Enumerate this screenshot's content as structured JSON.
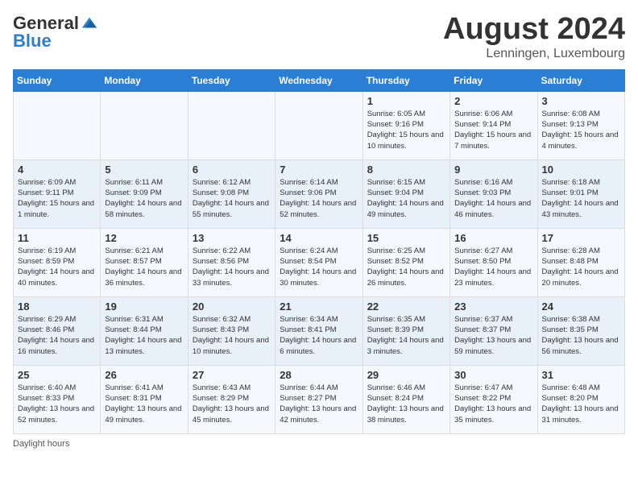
{
  "header": {
    "logo_general": "General",
    "logo_blue": "Blue",
    "month_year": "August 2024",
    "location": "Lenningen, Luxembourg"
  },
  "days_of_week": [
    "Sunday",
    "Monday",
    "Tuesday",
    "Wednesday",
    "Thursday",
    "Friday",
    "Saturday"
  ],
  "weeks": [
    [
      {
        "num": "",
        "detail": ""
      },
      {
        "num": "",
        "detail": ""
      },
      {
        "num": "",
        "detail": ""
      },
      {
        "num": "",
        "detail": ""
      },
      {
        "num": "1",
        "detail": "Sunrise: 6:05 AM\nSunset: 9:16 PM\nDaylight: 15 hours\nand 10 minutes."
      },
      {
        "num": "2",
        "detail": "Sunrise: 6:06 AM\nSunset: 9:14 PM\nDaylight: 15 hours\nand 7 minutes."
      },
      {
        "num": "3",
        "detail": "Sunrise: 6:08 AM\nSunset: 9:13 PM\nDaylight: 15 hours\nand 4 minutes."
      }
    ],
    [
      {
        "num": "4",
        "detail": "Sunrise: 6:09 AM\nSunset: 9:11 PM\nDaylight: 15 hours\nand 1 minute."
      },
      {
        "num": "5",
        "detail": "Sunrise: 6:11 AM\nSunset: 9:09 PM\nDaylight: 14 hours\nand 58 minutes."
      },
      {
        "num": "6",
        "detail": "Sunrise: 6:12 AM\nSunset: 9:08 PM\nDaylight: 14 hours\nand 55 minutes."
      },
      {
        "num": "7",
        "detail": "Sunrise: 6:14 AM\nSunset: 9:06 PM\nDaylight: 14 hours\nand 52 minutes."
      },
      {
        "num": "8",
        "detail": "Sunrise: 6:15 AM\nSunset: 9:04 PM\nDaylight: 14 hours\nand 49 minutes."
      },
      {
        "num": "9",
        "detail": "Sunrise: 6:16 AM\nSunset: 9:03 PM\nDaylight: 14 hours\nand 46 minutes."
      },
      {
        "num": "10",
        "detail": "Sunrise: 6:18 AM\nSunset: 9:01 PM\nDaylight: 14 hours\nand 43 minutes."
      }
    ],
    [
      {
        "num": "11",
        "detail": "Sunrise: 6:19 AM\nSunset: 8:59 PM\nDaylight: 14 hours\nand 40 minutes."
      },
      {
        "num": "12",
        "detail": "Sunrise: 6:21 AM\nSunset: 8:57 PM\nDaylight: 14 hours\nand 36 minutes."
      },
      {
        "num": "13",
        "detail": "Sunrise: 6:22 AM\nSunset: 8:56 PM\nDaylight: 14 hours\nand 33 minutes."
      },
      {
        "num": "14",
        "detail": "Sunrise: 6:24 AM\nSunset: 8:54 PM\nDaylight: 14 hours\nand 30 minutes."
      },
      {
        "num": "15",
        "detail": "Sunrise: 6:25 AM\nSunset: 8:52 PM\nDaylight: 14 hours\nand 26 minutes."
      },
      {
        "num": "16",
        "detail": "Sunrise: 6:27 AM\nSunset: 8:50 PM\nDaylight: 14 hours\nand 23 minutes."
      },
      {
        "num": "17",
        "detail": "Sunrise: 6:28 AM\nSunset: 8:48 PM\nDaylight: 14 hours\nand 20 minutes."
      }
    ],
    [
      {
        "num": "18",
        "detail": "Sunrise: 6:29 AM\nSunset: 8:46 PM\nDaylight: 14 hours\nand 16 minutes."
      },
      {
        "num": "19",
        "detail": "Sunrise: 6:31 AM\nSunset: 8:44 PM\nDaylight: 14 hours\nand 13 minutes."
      },
      {
        "num": "20",
        "detail": "Sunrise: 6:32 AM\nSunset: 8:43 PM\nDaylight: 14 hours\nand 10 minutes."
      },
      {
        "num": "21",
        "detail": "Sunrise: 6:34 AM\nSunset: 8:41 PM\nDaylight: 14 hours\nand 6 minutes."
      },
      {
        "num": "22",
        "detail": "Sunrise: 6:35 AM\nSunset: 8:39 PM\nDaylight: 14 hours\nand 3 minutes."
      },
      {
        "num": "23",
        "detail": "Sunrise: 6:37 AM\nSunset: 8:37 PM\nDaylight: 13 hours\nand 59 minutes."
      },
      {
        "num": "24",
        "detail": "Sunrise: 6:38 AM\nSunset: 8:35 PM\nDaylight: 13 hours\nand 56 minutes."
      }
    ],
    [
      {
        "num": "25",
        "detail": "Sunrise: 6:40 AM\nSunset: 8:33 PM\nDaylight: 13 hours\nand 52 minutes."
      },
      {
        "num": "26",
        "detail": "Sunrise: 6:41 AM\nSunset: 8:31 PM\nDaylight: 13 hours\nand 49 minutes."
      },
      {
        "num": "27",
        "detail": "Sunrise: 6:43 AM\nSunset: 8:29 PM\nDaylight: 13 hours\nand 45 minutes."
      },
      {
        "num": "28",
        "detail": "Sunrise: 6:44 AM\nSunset: 8:27 PM\nDaylight: 13 hours\nand 42 minutes."
      },
      {
        "num": "29",
        "detail": "Sunrise: 6:46 AM\nSunset: 8:24 PM\nDaylight: 13 hours\nand 38 minutes."
      },
      {
        "num": "30",
        "detail": "Sunrise: 6:47 AM\nSunset: 8:22 PM\nDaylight: 13 hours\nand 35 minutes."
      },
      {
        "num": "31",
        "detail": "Sunrise: 6:48 AM\nSunset: 8:20 PM\nDaylight: 13 hours\nand 31 minutes."
      }
    ]
  ],
  "footer": "Daylight hours"
}
